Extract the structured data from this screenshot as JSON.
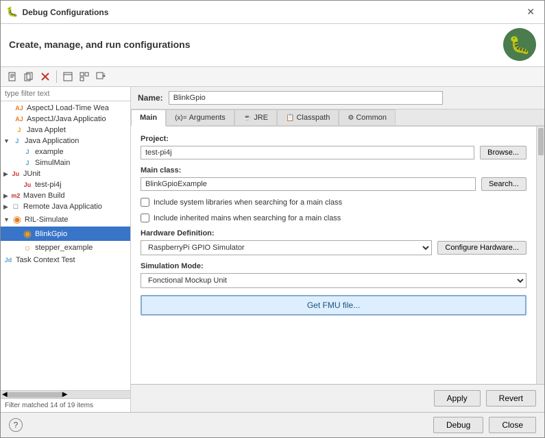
{
  "window": {
    "title": "Debug Configurations",
    "subtitle": "Create, manage, and run configurations"
  },
  "toolbar": {
    "buttons": [
      {
        "name": "new-config",
        "icon": "📄",
        "label": "New"
      },
      {
        "name": "duplicate",
        "icon": "⧉",
        "label": "Duplicate"
      },
      {
        "name": "delete",
        "icon": "✕",
        "label": "Delete"
      },
      {
        "name": "filter",
        "icon": "▣",
        "label": "Filter"
      },
      {
        "name": "collapse",
        "icon": "⊟",
        "label": "Collapse"
      },
      {
        "name": "more",
        "icon": "▾",
        "label": "More"
      }
    ]
  },
  "left_panel": {
    "filter_placeholder": "type filter text",
    "tree": [
      {
        "label": "AspectJ Load-Time Wea",
        "indent": 1,
        "icon": "AJ",
        "type": "aj"
      },
      {
        "label": "AspectJ/Java Applicatio",
        "indent": 1,
        "icon": "AJ",
        "type": "aj"
      },
      {
        "label": "Java Applet",
        "indent": 1,
        "icon": "J",
        "type": "java"
      },
      {
        "label": "Java Application",
        "indent": 0,
        "icon": "▼",
        "type": "folder",
        "expanded": true
      },
      {
        "label": "example",
        "indent": 2,
        "icon": "J",
        "type": "java"
      },
      {
        "label": "SimulMain",
        "indent": 2,
        "icon": "J",
        "type": "java"
      },
      {
        "label": "JUnit",
        "indent": 0,
        "icon": "▶",
        "type": "ju_folder"
      },
      {
        "label": "test-pi4j",
        "indent": 2,
        "icon": "Ju",
        "type": "ju"
      },
      {
        "label": "Maven Build",
        "indent": 0,
        "icon": "▶",
        "type": "m2_folder"
      },
      {
        "label": "Remote Java Applicatio",
        "indent": 0,
        "icon": "▶",
        "type": "remote"
      },
      {
        "label": "RIL-Simulate",
        "indent": 0,
        "icon": "◉",
        "type": "circle-orange",
        "expanded": true
      },
      {
        "label": "BlinkGpio",
        "indent": 2,
        "icon": "◉",
        "type": "circle-selected",
        "selected": true
      },
      {
        "label": "stepper_example",
        "indent": 2,
        "icon": "○",
        "type": "circle-outline"
      },
      {
        "label": "Task Context Test",
        "indent": 0,
        "icon": "Jd",
        "type": "jdt"
      }
    ],
    "filter_status": "Filter matched 14 of 19 items"
  },
  "right_panel": {
    "name_label": "Name:",
    "name_value": "BlinkGpio",
    "tabs": [
      {
        "label": "Main",
        "icon": "",
        "active": true
      },
      {
        "label": "Arguments",
        "icon": "(x)=",
        "active": false
      },
      {
        "label": "JRE",
        "icon": "☕",
        "active": false
      },
      {
        "label": "Classpath",
        "icon": "📋",
        "active": false
      },
      {
        "label": "Common",
        "icon": "⚙",
        "active": false
      }
    ],
    "project_label": "Project:",
    "project_value": "test-pi4j",
    "browse_label": "Browse...",
    "main_class_label": "Main class:",
    "main_class_value": "BlinkGpioExample",
    "search_label": "Search...",
    "checkbox1_label": "Include system libraries when searching for a main class",
    "checkbox2_label": "Include inherited mains when searching for a main class",
    "hardware_label": "Hardware Definition:",
    "hardware_value": "RaspberryPi GPIO Simulator",
    "configure_label": "Configure Hardware...",
    "simulation_label": "Simulation Mode:",
    "simulation_value": "Fonctional Mockup Unit",
    "get_fmu_label": "Get FMU file..."
  },
  "bottom_bar": {
    "apply_label": "Apply",
    "revert_label": "Revert"
  },
  "footer": {
    "debug_label": "Debug",
    "close_label": "Close"
  }
}
